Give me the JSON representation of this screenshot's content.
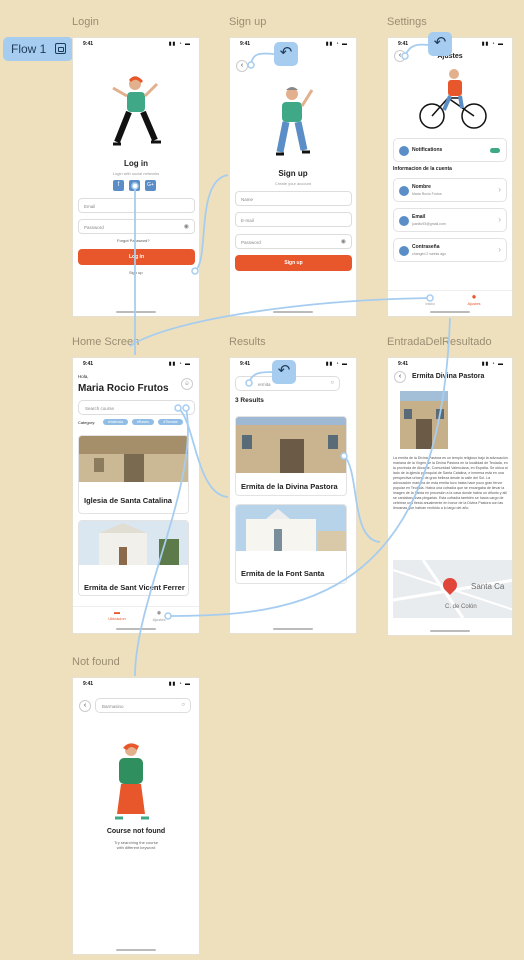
{
  "flow_tag": "Flow 1",
  "status": {
    "time": "9:41",
    "icons": "▮▮ ◔ ▬"
  },
  "frames": {
    "login": {
      "label": "Login",
      "title": "Log in",
      "subtitle": "Login with social networks",
      "social": [
        "f",
        "in",
        "G+"
      ],
      "email_placeholder": "Email",
      "password_placeholder": "Password",
      "forgot": "Forgot Password?",
      "login_button": "Log in",
      "signup_link": "Sign up"
    },
    "signup": {
      "label": "Sign up",
      "title": "Sign up",
      "subtitle": "Create your account",
      "name_placeholder": "Name",
      "email_placeholder": "E-mail",
      "password_placeholder": "Password",
      "button": "Sign up"
    },
    "settings": {
      "label": "Settings",
      "header": "Ajustes",
      "notifications": "Notifications",
      "section": "Informacion de la cuenta",
      "rows": [
        {
          "label": "Nombre",
          "value": "Maria Rocio Frutos"
        },
        {
          "label": "Email",
          "value": "juanito93@gmail.com"
        },
        {
          "label": "Contraseña",
          "value": "changed 2 weeks ago"
        }
      ],
      "tabs": [
        "Inicio",
        "Ajustes"
      ]
    },
    "home": {
      "label": "Home Screen",
      "greeting": "Hola,",
      "name": "Maria Rocio Frutos",
      "search_placeholder": "Search course",
      "category_label": "Category:",
      "chips": [
        "#Valencia",
        "#Rastro",
        "#Tiendas"
      ],
      "cards": [
        "Iglesia de Santa Catalina",
        "Ermita de Sant Vicent Ferrer"
      ],
      "tabs": [
        "Ubicacion",
        "Ajustes"
      ]
    },
    "results": {
      "label": "Results",
      "query": "ermita",
      "count": "3 Results",
      "cards": [
        "Ermita de la Divina Pastora",
        "Ermita de la Font Santa"
      ]
    },
    "detail": {
      "label": "EntradaDelResultado",
      "title": "Ermita Divina Pastora",
      "body": "La ermita de la Divina Pastora es un templo religioso bajo la advocación mariana de la Virgen de la Divina Pastora en la localidad de Teulada, en la provincia de Alicante, Comunidad Valenciana, en España. Se ubica al lado de la iglesia parroquial de Santa Catalina, e inmersa está en una perspectiva urbana de gran belleza desde la calle del Sol. La advocación mariana de esta ermita tuvo hasta hace poco gran fervor popular en Teulada. Había una cofradía que se encargaba de llevar la imagen de la Santa en procesión a la casa donde había un difunto y allí se cantaban unas plegarias. Esta cofradía también se hacía cargo de celebrar una fiesta anualmente en honor de la Divina Pastora con las limosnas que habían recibido a lo largo del año.",
      "map_labels": [
        "Santa Ca",
        "C. de Colón"
      ]
    },
    "notfound": {
      "label": "Not found",
      "search_value": "Barmasino",
      "title": "Course not found",
      "subtitle": "Try searching the course with different keyword"
    }
  },
  "colors": {
    "accent": "#e8572b",
    "flow": "#a6cdf0",
    "canvas": "#efe0bd"
  }
}
